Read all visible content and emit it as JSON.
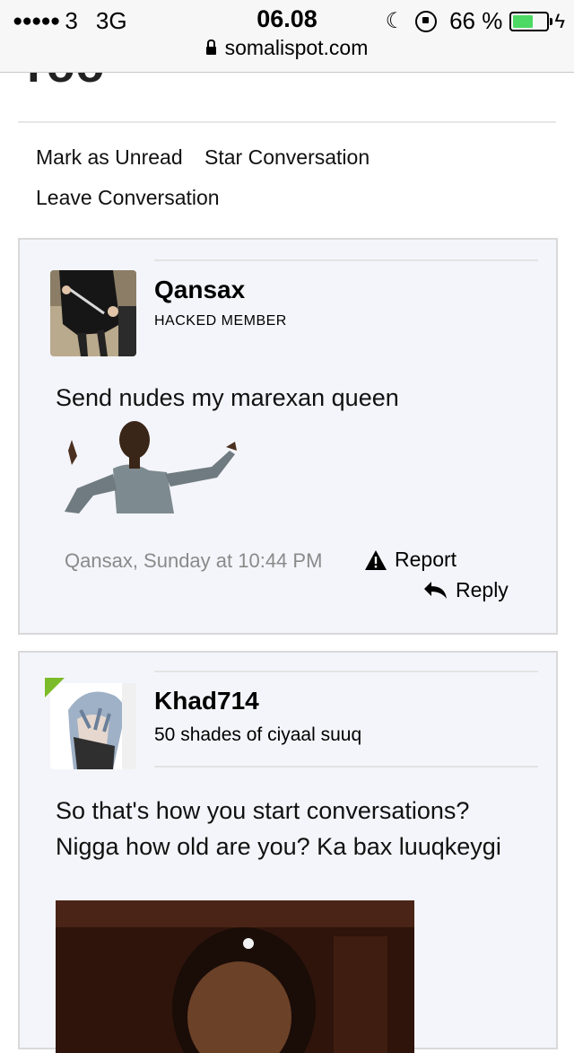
{
  "status_bar": {
    "signal_dots": "●●●●●",
    "carrier": "3",
    "network": "3G",
    "time": "06.08",
    "battery_percent": "66 %",
    "battery_level": 0.66,
    "url": "somalispot.com"
  },
  "page": {
    "clipped_title": "Yoo"
  },
  "conversation_actions": {
    "mark_unread": "Mark as Unread",
    "star": "Star Conversation",
    "leave": "Leave Conversation"
  },
  "messages": [
    {
      "username": "Qansax",
      "user_title": "HACKED MEMBER",
      "text": "Send nudes my marexan queen",
      "meta": "Qansax, Sunday at 10:44 PM",
      "report_label": "Report",
      "reply_label": "Reply"
    },
    {
      "username": "Khad714",
      "user_title": "50 shades of ciyaal suuq",
      "text": "So that's how you start conversations? Nigga how old are you? Ka bax luuqkeygi"
    }
  ],
  "colors": {
    "message_bg": "#f4f5fa",
    "border": "#d9d9d9",
    "meta_text": "#8a8a8a",
    "battery_fill": "#4cd964",
    "online_badge": "#7cbb2a"
  },
  "icons": [
    "lock-icon",
    "moon-icon",
    "rotation-lock-icon",
    "battery-icon",
    "warning-icon",
    "reply-icon"
  ]
}
